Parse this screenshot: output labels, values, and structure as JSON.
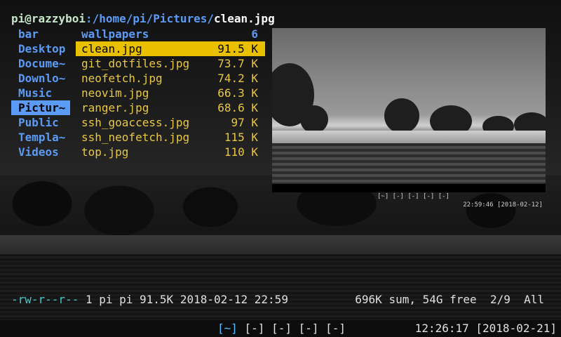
{
  "title_bar": {
    "user_host": "pi@razzyboi",
    "path": ":/home/pi/Pictures/",
    "file": "clean.jpg"
  },
  "parent_dirs": [
    {
      "label": "bar"
    },
    {
      "label": "Desktop"
    },
    {
      "label": "Docume~"
    },
    {
      "label": "Downlo~"
    },
    {
      "label": "Music"
    },
    {
      "label": "Pictur~"
    },
    {
      "label": "Public"
    },
    {
      "label": "Templa~"
    },
    {
      "label": "Videos"
    }
  ],
  "files": [
    {
      "name": "wallpapers",
      "size": "6"
    },
    {
      "name": "clean.jpg",
      "size": "91.5 K"
    },
    {
      "name": "git_dotfiles.jpg",
      "size": "73.7 K"
    },
    {
      "name": "neofetch.jpg",
      "size": "74.2 K"
    },
    {
      "name": "neovim.jpg",
      "size": "66.3 K"
    },
    {
      "name": "ranger.jpg",
      "size": "68.6 K"
    },
    {
      "name": "ssh_goaccess.jpg",
      "size": "97 K"
    },
    {
      "name": "ssh_neofetch.jpg",
      "size": "115 K"
    },
    {
      "name": "top.jpg",
      "size": "110 K"
    }
  ],
  "preview_status": {
    "left": "[~] [-] [-] [-] [-]",
    "right": "22:59:46 [2018-02-12]"
  },
  "info_line": {
    "permissions": "-rw-r--r--",
    "details": " 1 pi pi 91.5K 2018-02-12 22:59",
    "summary": "696K sum, 54G free  2/9  All"
  },
  "tmux": {
    "active_window": "[~]",
    "windows": " [-] [-] [-] [-]",
    "clock": "12:26:17 [2018-02-21]"
  },
  "colors": {
    "directory": "#5b9bf5",
    "file": "#e8c840",
    "selection_file": "#e8c000",
    "permissions": "#4cc7c7",
    "prompt_user": "#c8e6c9"
  }
}
